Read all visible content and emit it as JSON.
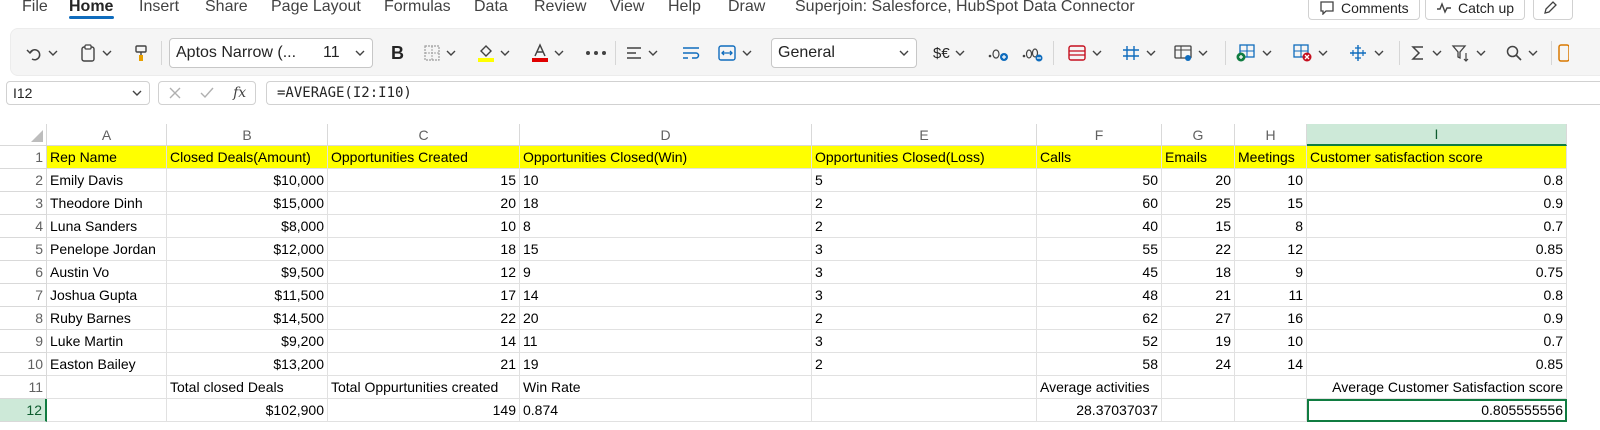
{
  "menu": {
    "items": [
      "File",
      "Home",
      "Insert",
      "Share",
      "Page Layout",
      "Formulas",
      "Data",
      "Review",
      "View",
      "Help",
      "Draw",
      "Superjoin: Salesforce, HubSpot Data Connector"
    ],
    "active": "Home",
    "comments_label": "Comments",
    "catchup_label": "Catch up"
  },
  "ribbon": {
    "font_name": "Aptos Narrow (...",
    "font_size": "11",
    "bold_label": "B",
    "number_format": "General",
    "currency_label": "$€"
  },
  "formula_bar": {
    "name_box": "I12",
    "fx_label": "fx",
    "formula": "=AVERAGE(I2:I10)"
  },
  "columns": [
    "A",
    "B",
    "C",
    "D",
    "E",
    "F",
    "G",
    "H",
    "I"
  ],
  "selected_column": "I",
  "selected_row": "12",
  "rows": [
    {
      "n": "1",
      "cells": [
        "Rep Name",
        "Closed Deals(Amount)",
        "Opportunities Created",
        "Opportunities Closed(Win)",
        "Opportunities Closed(Loss)",
        "Calls",
        "Emails",
        "Meetings",
        "Customer satisfaction score"
      ]
    },
    {
      "n": "2",
      "cells": [
        "Emily Davis",
        "$10,000",
        "15",
        "10",
        "5",
        "50",
        "20",
        "10",
        "0.8"
      ]
    },
    {
      "n": "3",
      "cells": [
        "Theodore Dinh",
        "$15,000",
        "20",
        "18",
        "2",
        "60",
        "25",
        "15",
        "0.9"
      ]
    },
    {
      "n": "4",
      "cells": [
        "Luna Sanders",
        "$8,000",
        "10",
        "8",
        "2",
        "40",
        "15",
        "8",
        "0.7"
      ]
    },
    {
      "n": "5",
      "cells": [
        "Penelope Jordan",
        "$12,000",
        "18",
        "15",
        "3",
        "55",
        "22",
        "12",
        "0.85"
      ]
    },
    {
      "n": "6",
      "cells": [
        "Austin Vo",
        "$9,500",
        "12",
        "9",
        "3",
        "45",
        "18",
        "9",
        "0.75"
      ]
    },
    {
      "n": "7",
      "cells": [
        "Joshua Gupta",
        "$11,500",
        "17",
        "14",
        "3",
        "48",
        "21",
        "11",
        "0.8"
      ]
    },
    {
      "n": "8",
      "cells": [
        "Ruby Barnes",
        "$14,500",
        "22",
        "20",
        "2",
        "62",
        "27",
        "16",
        "0.9"
      ]
    },
    {
      "n": "9",
      "cells": [
        "Luke Martin",
        "$9,200",
        "14",
        "11",
        "3",
        "52",
        "19",
        "10",
        "0.7"
      ]
    },
    {
      "n": "10",
      "cells": [
        "Easton Bailey",
        "$13,200",
        "21",
        "19",
        "2",
        "58",
        "24",
        "14",
        "0.85"
      ]
    },
    {
      "n": "11",
      "cells": [
        "",
        "Total closed Deals",
        "Total Oppurtunities created",
        "Win Rate",
        "",
        "Average activities",
        "",
        "",
        "Average Customer Satisfaction score"
      ]
    },
    {
      "n": "12",
      "cells": [
        "",
        "$102,900",
        "149",
        "0.874",
        "",
        "28.37037037",
        "",
        "",
        "0.805555556"
      ]
    }
  ],
  "colors": {
    "header_fill": "#ffff00",
    "selection_green": "#107c41",
    "selection_header": "#cde9d8",
    "accent_blue": "#0f6cbd"
  }
}
